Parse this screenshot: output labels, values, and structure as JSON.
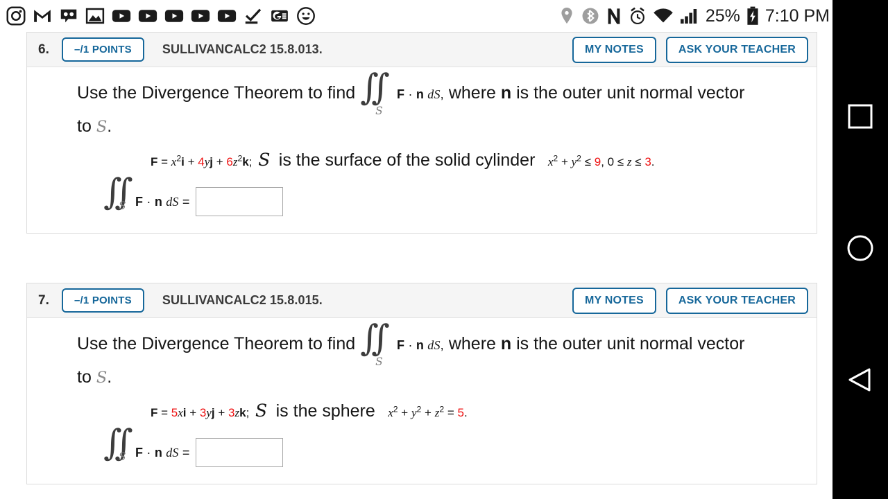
{
  "status_bar": {
    "notification_icons": [
      "instagram-icon",
      "gmail-icon",
      "voicemail-icon",
      "gallery-icon",
      "youtube-icon-1",
      "youtube-icon-2",
      "youtube-icon-3",
      "youtube-icon-4",
      "youtube-icon-5",
      "tasks-check-icon",
      "google-news-icon",
      "smiley-icon"
    ],
    "system_icons": [
      "location-icon",
      "bluetooth-icon",
      "nfc-icon",
      "alarm-icon",
      "wifi-icon",
      "cellular-signal-icon",
      "battery-charging-icon"
    ],
    "battery_percent": "25%",
    "clock": "7:10 PM"
  },
  "nav_bar": {
    "recents_label": "recents-square-icon",
    "home_label": "home-circle-icon",
    "back_label": "back-triangle-icon"
  },
  "problems": [
    {
      "number": "6.",
      "points": "–/1 POINTS",
      "code": "SULLIVANCALC2 15.8.013.",
      "my_notes": "MY NOTES",
      "ask_teacher": "ASK YOUR TEACHER",
      "prompt_lead": "Use the Divergence Theorem to find",
      "integral_sub": "S",
      "integral_expr": "F · n dS,",
      "prompt_tail": "where",
      "prompt_bold": "n",
      "prompt_tail2": "is the outer unit normal vector",
      "prompt_line2_pre": "to",
      "prompt_line2_S": "S",
      "prompt_line2_post": ".",
      "field_label": "F",
      "field_eq": "=",
      "field_terms": [
        {
          "coef": "",
          "coef_red": false,
          "var": "x",
          "exp": "2",
          "unit": "i"
        },
        {
          "coef": "4",
          "coef_red": true,
          "var": "y",
          "exp": "",
          "unit": "j"
        },
        {
          "coef": "6",
          "coef_red": true,
          "var": "z",
          "exp": "2",
          "unit": "k"
        }
      ],
      "field_semicolon": ";",
      "surface_S": "S",
      "surface_text": "is the surface of the solid cylinder",
      "condition_html": "x<sup>2</sup> + y<sup>2</sup> ≤ <span class=\"red\">9</span>, 0 ≤ z ≤ <span class=\"red\">3</span>.",
      "answer_prefix": "F · n dS =",
      "answer_value": "",
      "answer_placeholder": ""
    },
    {
      "number": "7.",
      "points": "–/1 POINTS",
      "code": "SULLIVANCALC2 15.8.015.",
      "my_notes": "MY NOTES",
      "ask_teacher": "ASK YOUR TEACHER",
      "prompt_lead": "Use the Divergence Theorem to find",
      "integral_sub": "S",
      "integral_expr": "F · n dS,",
      "prompt_tail": "where",
      "prompt_bold": "n",
      "prompt_tail2": "is the outer unit normal vector",
      "prompt_line2_pre": "to",
      "prompt_line2_S": "S",
      "prompt_line2_post": ".",
      "field_label": "F",
      "field_eq": "=",
      "field_terms": [
        {
          "coef": "5",
          "coef_red": true,
          "var": "x",
          "exp": "",
          "unit": "i"
        },
        {
          "coef": "3",
          "coef_red": true,
          "var": "y",
          "exp": "",
          "unit": "j"
        },
        {
          "coef": "3",
          "coef_red": true,
          "var": "z",
          "exp": "",
          "unit": "k"
        }
      ],
      "field_semicolon": ";",
      "surface_S": "S",
      "surface_text": "is the sphere",
      "condition_html": "x<sup>2</sup> + y<sup>2</sup> + z<sup>2</sup> = <span class=\"red\">5</span>.",
      "answer_prefix": "F · n dS =",
      "answer_value": "",
      "answer_placeholder": ""
    }
  ],
  "colors": {
    "accent_blue": "#16679a",
    "red": "#ee1111",
    "header_gray": "#f5f5f5",
    "nav_black": "#000000"
  }
}
